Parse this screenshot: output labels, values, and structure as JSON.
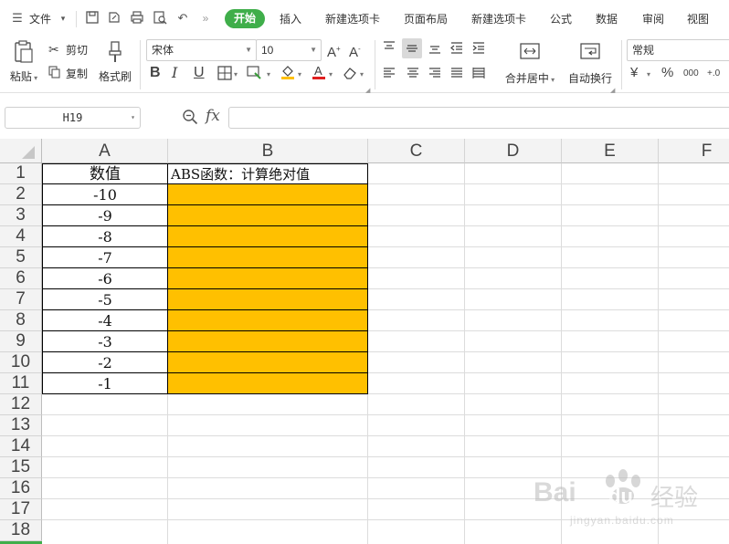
{
  "menubar": {
    "file_label": "文件",
    "tabs": [
      "开始",
      "插入",
      "新建选项卡",
      "页面布局",
      "新建选项卡",
      "公式",
      "数据",
      "审阅",
      "视图"
    ],
    "active_tab": "开始"
  },
  "ribbon": {
    "paste": "粘贴",
    "cut": "剪切",
    "copy": "复制",
    "format_painter": "格式刷",
    "font_name": "宋体",
    "font_size": "10",
    "merge_center": "合并居中",
    "wrap_text": "自动换行",
    "number_format": "常规",
    "currency_symbol": "¥",
    "percent_symbol": "%",
    "thousands_symbol": "000",
    "decimal_symbol": "+.0"
  },
  "formula_bar": {
    "cell_ref": "H19",
    "fx_label": "fx",
    "formula": ""
  },
  "grid": {
    "columns": [
      "A",
      "B",
      "C",
      "D",
      "E",
      "F"
    ],
    "rows": [
      "1",
      "2",
      "3",
      "4",
      "5",
      "6",
      "7",
      "8",
      "9",
      "10",
      "11",
      "12",
      "13",
      "14",
      "15",
      "16",
      "17",
      "18"
    ],
    "a1": "数值",
    "b1": "ABS函数：计算绝对值",
    "values": [
      "-10",
      "-9",
      "-8",
      "-7",
      "-6",
      "-5",
      "-4",
      "-3",
      "-2",
      "-1"
    ],
    "highlight_color": "#ffc000"
  },
  "watermark": {
    "brand": "Bai",
    "brand2": "du",
    "product": "经验",
    "url": "jingyan.baidu.com"
  }
}
